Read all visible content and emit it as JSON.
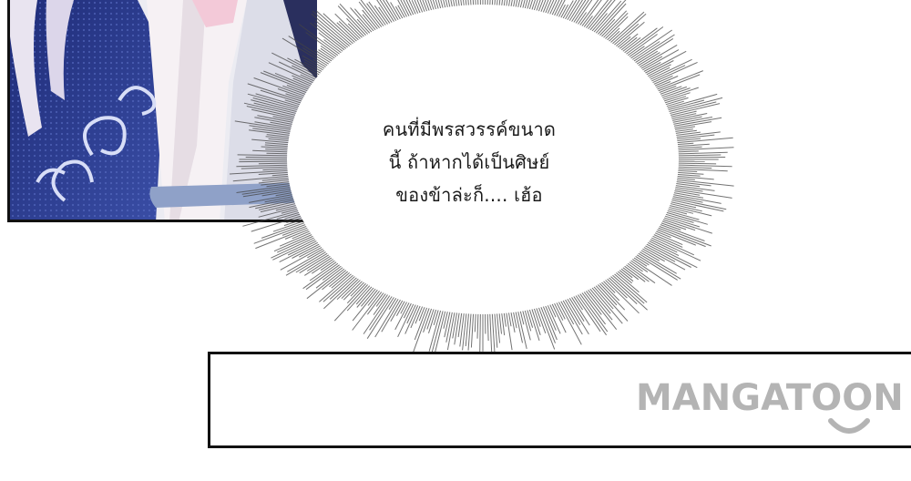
{
  "speech_bubble": {
    "lines": [
      "คนที่มีพรสวรรค์ขนาด",
      "นี้ ถ้าหากได้เป็นศิษย์",
      "ของข้าล่ะก็.... เฮ้อ"
    ]
  },
  "watermark": {
    "text": "MANGATOON"
  },
  "colors": {
    "robe_blue": "#2b3a8a",
    "robe_white": "#f4eef2",
    "hair_pink": "#f3c9d8",
    "watermark_gray": "#b4b4b4",
    "border": "#111111"
  }
}
